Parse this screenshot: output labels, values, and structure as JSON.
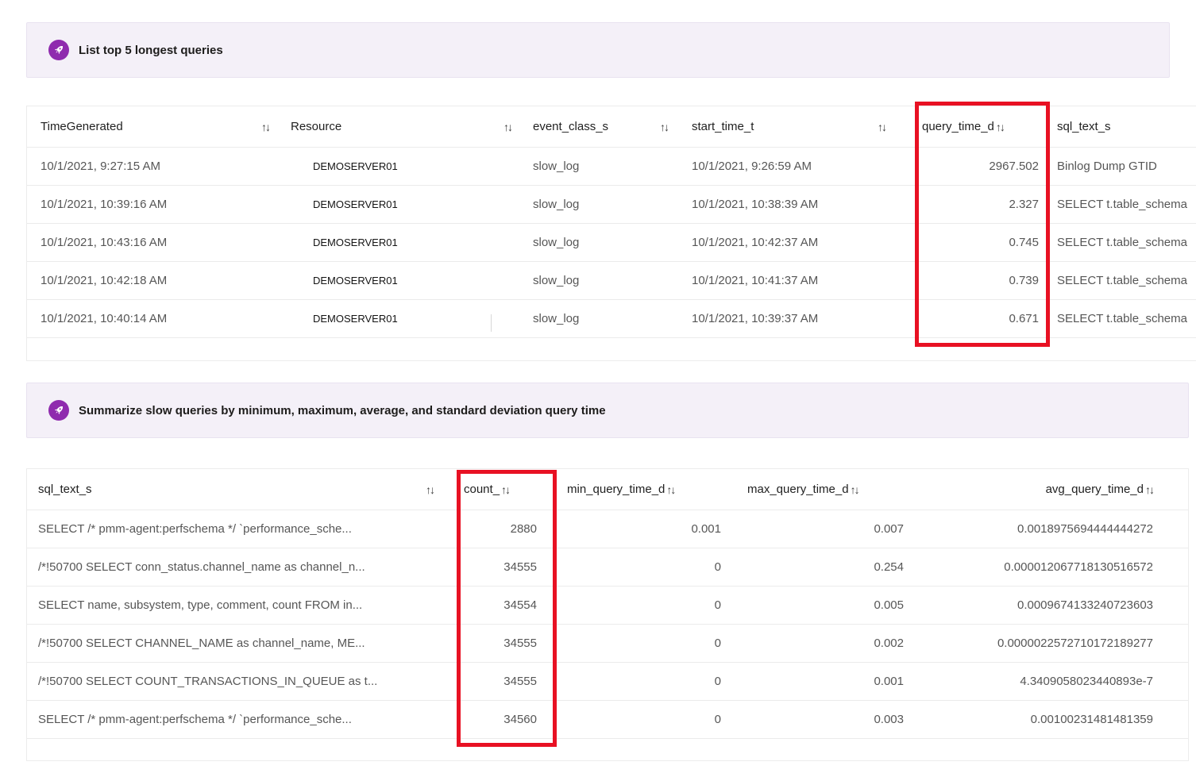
{
  "colors": {
    "accent_purple": "#8f2bae",
    "banner_background": "#f4f0f8",
    "highlight_red": "#e81123"
  },
  "sort_icon": "↑↓",
  "banners": [
    {
      "label": "List top 5 longest queries"
    },
    {
      "label": "Summarize slow queries by minimum, maximum, average, and standard deviation query time"
    }
  ],
  "table1": {
    "headers": [
      "TimeGenerated",
      "Resource",
      "event_class_s",
      "start_time_t",
      "query_time_d",
      "sql_text_s"
    ],
    "rows": [
      [
        "10/1/2021, 9:27:15 AM",
        "DEMOSERVER01",
        "slow_log",
        "10/1/2021, 9:26:59 AM",
        "2967.502",
        "Binlog Dump GTID"
      ],
      [
        "10/1/2021, 10:39:16 AM",
        "DEMOSERVER01",
        "slow_log",
        "10/1/2021, 10:38:39 AM",
        "2.327",
        "SELECT t.table_schema"
      ],
      [
        "10/1/2021, 10:43:16 AM",
        "DEMOSERVER01",
        "slow_log",
        "10/1/2021, 10:42:37 AM",
        "0.745",
        "SELECT t.table_schema"
      ],
      [
        "10/1/2021, 10:42:18 AM",
        "DEMOSERVER01",
        "slow_log",
        "10/1/2021, 10:41:37 AM",
        "0.739",
        "SELECT t.table_schema"
      ],
      [
        "10/1/2021, 10:40:14 AM",
        "DEMOSERVER01",
        "slow_log",
        "10/1/2021, 10:39:37 AM",
        "0.671",
        "SELECT t.table_schema"
      ]
    ]
  },
  "table2": {
    "headers": [
      "sql_text_s",
      "count_",
      "min_query_time_d",
      "max_query_time_d",
      "avg_query_time_d"
    ],
    "rows": [
      [
        "SELECT /* pmm-agent:perfschema */ `performance_sche...",
        "2880",
        "0.001",
        "0.007",
        "0.0018975694444444272"
      ],
      [
        "/*!50700 SELECT conn_status.channel_name as channel_n...",
        "34555",
        "0",
        "0.254",
        "0.000012067718130516572"
      ],
      [
        "SELECT name, subsystem, type, comment, count FROM in...",
        "34554",
        "0",
        "0.005",
        "0.0009674133240723603"
      ],
      [
        "/*!50700 SELECT CHANNEL_NAME as channel_name, ME...",
        "34555",
        "0",
        "0.002",
        "0.0000022572710172189277"
      ],
      [
        "/*!50700 SELECT COUNT_TRANSACTIONS_IN_QUEUE as t...",
        "34555",
        "0",
        "0.001",
        "4.3409058023440893e-7"
      ],
      [
        "SELECT /* pmm-agent:perfschema */ `performance_sche...",
        "34560",
        "0",
        "0.003",
        "0.00100231481481359"
      ]
    ]
  }
}
